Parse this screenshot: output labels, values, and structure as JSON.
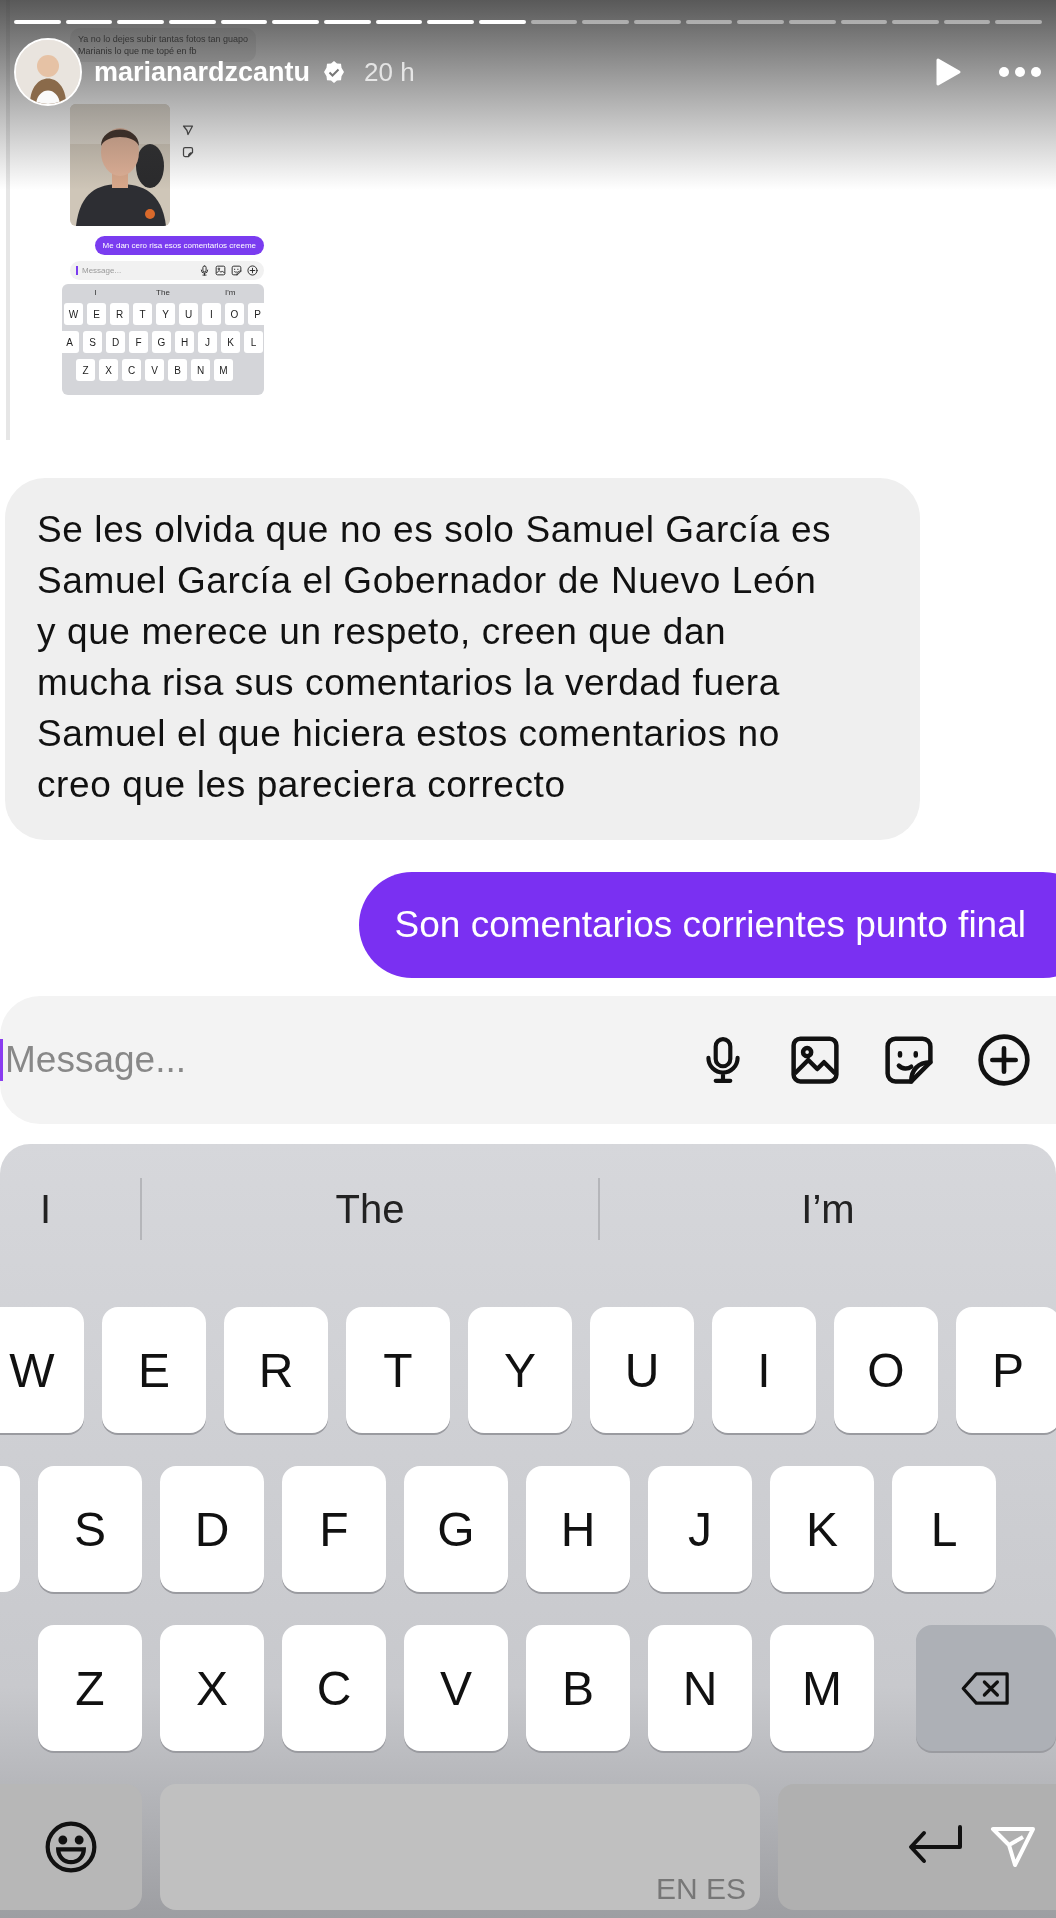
{
  "story_progress": {
    "level": 0.5
  },
  "header": {
    "username": "marianardzcantu",
    "verified": true,
    "time": "20 h"
  },
  "shared_screenshot": {
    "received_message": {
      "lines": [
        "Ya no lo dejes subir tantas fotos tan guapo",
        "Marianis lo que me topé en fb"
      ]
    },
    "sent_message": "Me dan cero risa esos comentarios creeme",
    "composer": {
      "placeholder": "Message..."
    },
    "keyboard": {
      "suggestions": [
        "I",
        "The",
        "I'm"
      ],
      "rows": [
        [
          "W",
          "E",
          "R",
          "T",
          "Y",
          "U",
          "I",
          "O",
          "P"
        ],
        [
          "A",
          "S",
          "D",
          "F",
          "G",
          "H",
          "J",
          "K",
          "L"
        ],
        [
          "Z",
          "X",
          "C",
          "V",
          "B",
          "N",
          "M"
        ]
      ]
    }
  },
  "messages": [
    {
      "kind": "received",
      "text": "Se les olvida que no es solo Samuel García es Samuel García el Gobernador de Nuevo León y que merece un respeto, creen que dan mucha risa sus comentarios la verdad fuera Samuel el que hiciera estos comentarios no creo que les pareciera correcto"
    },
    {
      "kind": "sent",
      "text": "Son comentarios corrientes punto final"
    }
  ],
  "composer": {
    "placeholder": "Message..."
  },
  "keyboard": {
    "suggestions": [
      "I",
      "The",
      "I’m"
    ],
    "rows": [
      [
        "W",
        "E",
        "R",
        "T",
        "Y",
        "U",
        "I",
        "O",
        "P"
      ],
      [
        "S",
        "D",
        "F",
        "G",
        "H",
        "J",
        "K",
        "L"
      ],
      [
        "Z",
        "X",
        "C",
        "V",
        "B",
        "N",
        "M"
      ]
    ],
    "language": "EN ES"
  }
}
